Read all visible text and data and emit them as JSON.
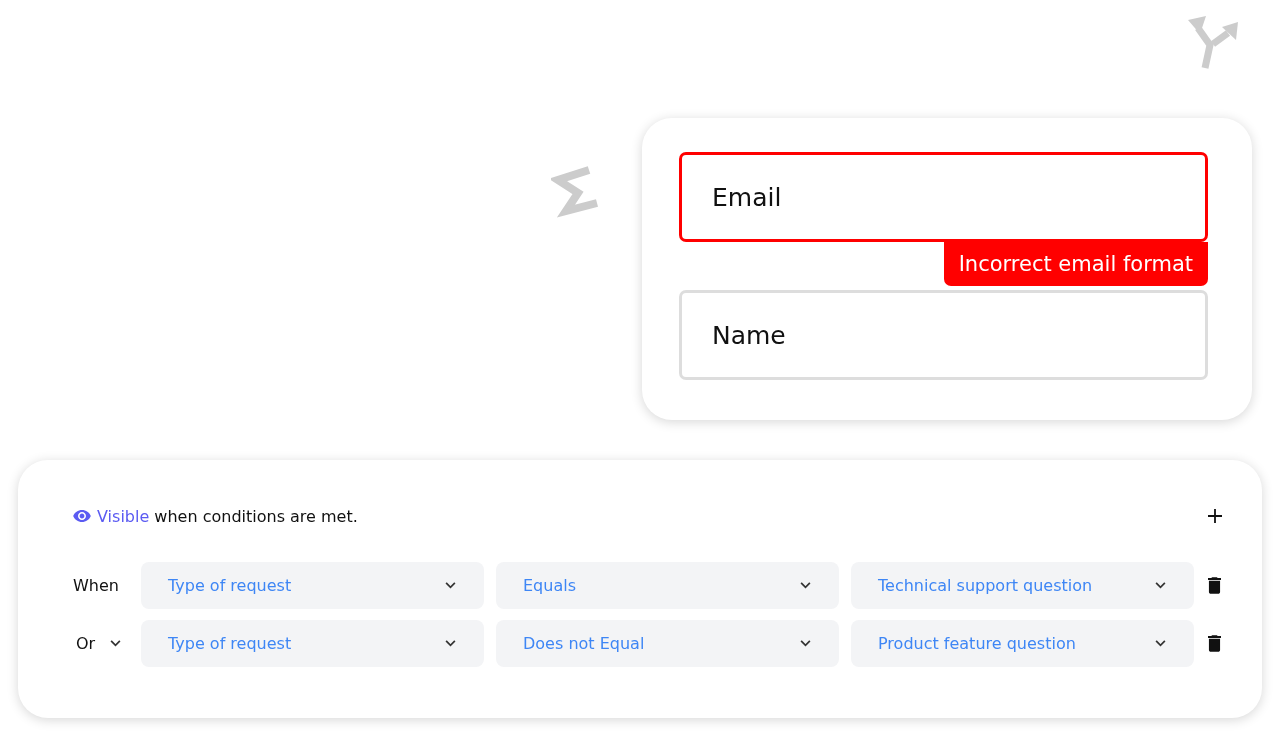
{
  "form_preview": {
    "fields": [
      {
        "placeholder": "Email",
        "invalid": true,
        "error": "Incorrect email format"
      },
      {
        "placeholder": "Name",
        "invalid": false
      }
    ]
  },
  "visibility_rule": {
    "mode": "Visible",
    "text": "when conditions are met.",
    "conditions": [
      {
        "connector": {
          "text": "When",
          "kind": "label"
        },
        "field": "Type of request",
        "operator": "Equals",
        "value": "Technical support question"
      },
      {
        "connector": {
          "text": "Or",
          "kind": "dropdown"
        },
        "field": "Type of request",
        "operator": "Does not Equal",
        "value": "Product feature question"
      }
    ]
  }
}
